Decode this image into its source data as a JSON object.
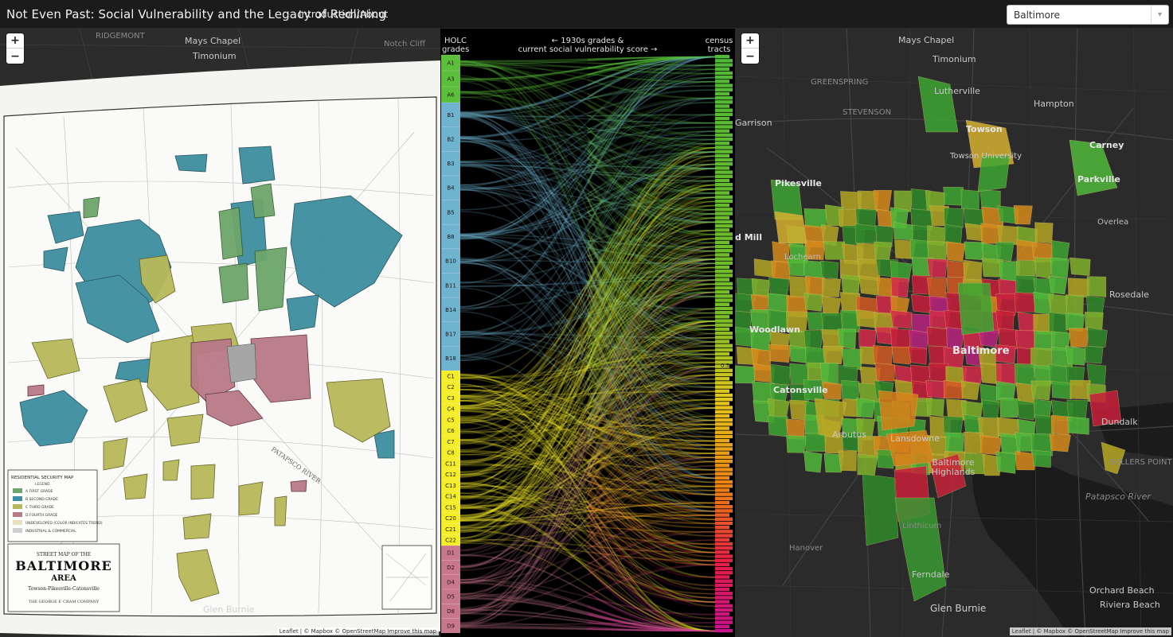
{
  "app": {
    "title": "Not Even Past: Social Vulnerability and the Legacy of Redlining",
    "nav_link": "Introduction/About",
    "city_select": {
      "value": "Baltimore"
    }
  },
  "left_map": {
    "zoom_in": "+",
    "zoom_out": "−",
    "scan_title_line1": "STREET MAP OF THE",
    "scan_title_line2": "BALTIMORE",
    "scan_title_line3": "AREA",
    "scan_subtitle": "Towson-Pikesville-Catonsville",
    "scan_publisher": "THE GEORGE F. CRAM COMPANY",
    "legend_title": "RESIDENTIAL SECURITY MAP",
    "legend_subtitle": "LEGEND",
    "legend_items": [
      "A FIRST GRADE",
      "B SECOND GRADE",
      "C THIRD GRADE",
      "D FOURTH GRADE",
      "UNDEVELOPED (COLOR INDICATES TREND)",
      "INDUSTRIAL & COMMERCIAL"
    ],
    "river_label": "PATAPSCO RIVER",
    "labels": [
      "RIDGEMONT",
      "Mays Chapel",
      "Notch Cliff",
      "Timonium",
      "Glen Burnie"
    ],
    "attribution": "Leaflet | © Mapbox © OpenStreetMap Improve this map"
  },
  "middle": {
    "holc_header_1": "HOLC",
    "holc_header_2": "grades",
    "center_header_1": "← 1930s grades &",
    "center_header_2": "current social vulnerability score →",
    "tracts_header_1": "census",
    "tracts_header_2": "tracts",
    "grades": [
      {
        "label": "A1",
        "group": "A"
      },
      {
        "label": "A3",
        "group": "A"
      },
      {
        "label": "A6",
        "group": "A"
      },
      {
        "label": "B1",
        "group": "B"
      },
      {
        "label": "B2",
        "group": "B"
      },
      {
        "label": "B3",
        "group": "B"
      },
      {
        "label": "B4",
        "group": "B"
      },
      {
        "label": "B5",
        "group": "B"
      },
      {
        "label": "B8",
        "group": "B"
      },
      {
        "label": "B10",
        "group": "B"
      },
      {
        "label": "B11",
        "group": "B"
      },
      {
        "label": "B14",
        "group": "B"
      },
      {
        "label": "B17",
        "group": "B"
      },
      {
        "label": "B18",
        "group": "B"
      },
      {
        "label": "C1",
        "group": "C"
      },
      {
        "label": "C2",
        "group": "C"
      },
      {
        "label": "C3",
        "group": "C"
      },
      {
        "label": "C4",
        "group": "C"
      },
      {
        "label": "C5",
        "group": "C"
      },
      {
        "label": "C6",
        "group": "C"
      },
      {
        "label": "C7",
        "group": "C"
      },
      {
        "label": "C8",
        "group": "C"
      },
      {
        "label": "C11",
        "group": "C"
      },
      {
        "label": "C12",
        "group": "C"
      },
      {
        "label": "C13",
        "group": "C"
      },
      {
        "label": "C14",
        "group": "C"
      },
      {
        "label": "C15",
        "group": "C"
      },
      {
        "label": "C20",
        "group": "C"
      },
      {
        "label": "C21",
        "group": "C"
      },
      {
        "label": "C22",
        "group": "C"
      },
      {
        "label": "D1",
        "group": "D"
      },
      {
        "label": "D2",
        "group": "D"
      },
      {
        "label": "D4",
        "group": "D"
      },
      {
        "label": "D5",
        "group": "D"
      },
      {
        "label": "D8",
        "group": "D"
      },
      {
        "label": "D9",
        "group": "D"
      }
    ],
    "tract_score_label": "0.5"
  },
  "right_map": {
    "zoom_in": "+",
    "zoom_out": "−",
    "labels": {
      "mays_chapel": "Mays Chapel",
      "timonium": "Timonium",
      "lutherville": "Lutherville",
      "hampton": "Hampton",
      "towson": "Towson",
      "towson_university": "Towson University",
      "carney": "Carney",
      "parkville": "Parkville",
      "pikesville": "Pikesville",
      "overlea": "Overlea",
      "mill": "d Mill",
      "lochearn": "Lochearn",
      "rosedale": "Rosedale",
      "woodlawn": "Woodlawn",
      "baltimore": "Baltimore",
      "catonsville": "Catonsville",
      "arbutus": "Arbutus",
      "lansdowne": "Lansdowne",
      "baltimore_highlands": "Baltimore Highlands",
      "dundalk": "Dundalk",
      "patapsco_river": "Patapsco River",
      "ferndale": "Ferndale",
      "glen_burnie": "Glen Burnie",
      "riviera_beach": "Riviera Beach",
      "orchard_beach": "Orchard Beach",
      "hanover": "Hanover",
      "linthicum": "Linthicum",
      "garrison": "Garrison",
      "greenspring": "GREENSPRING",
      "stevenson": "STEVENSON",
      "sparrows_point": "SOLLERS POINT"
    },
    "attribution": "Leaflet | © Mapbox © OpenStreetMap Improve this map"
  },
  "colors": {
    "holc_a": "#5cbf3c",
    "holc_b": "#6fb3cf",
    "holc_c": "#f5ed2a",
    "holc_d": "#c9788b",
    "sv_low": "#4fb83a",
    "sv_mid": "#e0a020",
    "sv_high": "#e0245a",
    "sv_max": "#c0188c"
  }
}
